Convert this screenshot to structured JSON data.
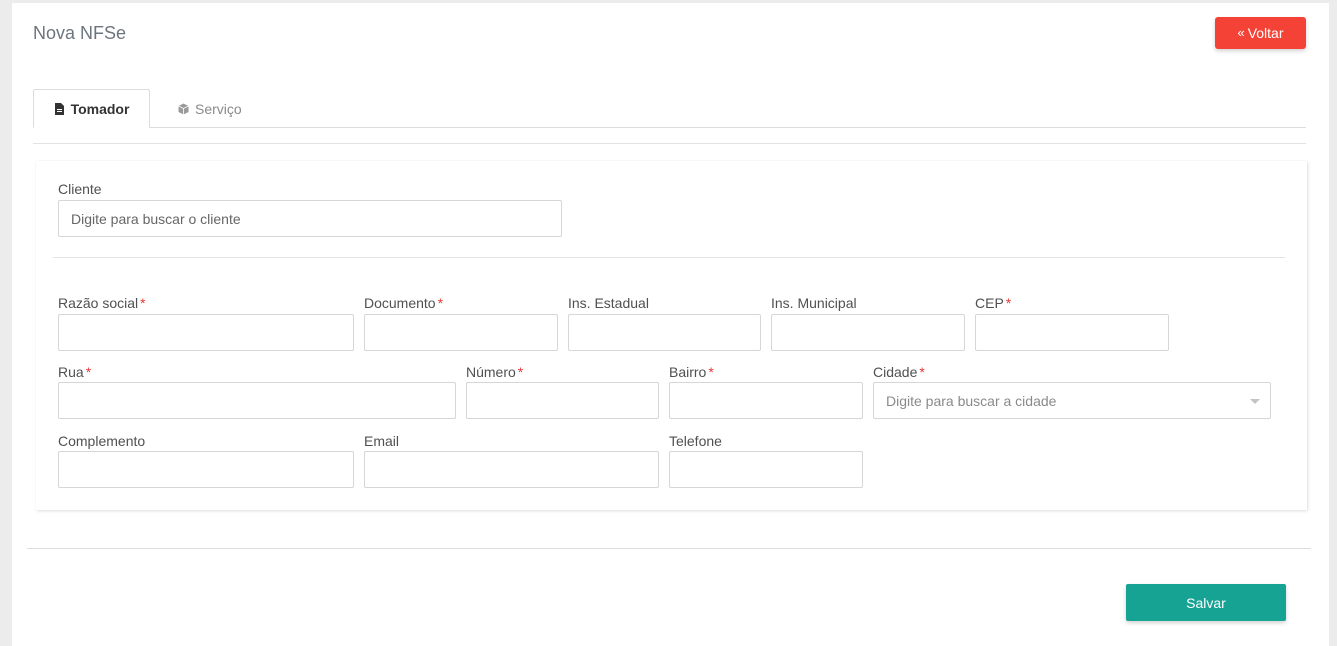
{
  "header": {
    "title": "Nova NFSe",
    "back_icon": "chevron-double-left-icon",
    "back_label": "Voltar"
  },
  "tabs": [
    {
      "label": "Tomador",
      "icon": "file-icon",
      "active": true
    },
    {
      "label": "Serviço",
      "icon": "cube-icon",
      "active": false
    }
  ],
  "form": {
    "cliente": {
      "label": "Cliente",
      "placeholder": "Digite para buscar o cliente",
      "value": ""
    },
    "razao_social": {
      "label": "Razão social",
      "required": "*",
      "value": ""
    },
    "documento": {
      "label": "Documento",
      "required": "*",
      "value": ""
    },
    "ins_estadual": {
      "label": "Ins. Estadual",
      "value": ""
    },
    "ins_municipal": {
      "label": "Ins. Municipal",
      "value": ""
    },
    "cep": {
      "label": "CEP",
      "required": "*",
      "value": ""
    },
    "rua": {
      "label": "Rua",
      "required": "*",
      "value": ""
    },
    "numero": {
      "label": "Número",
      "required": "*",
      "value": ""
    },
    "bairro": {
      "label": "Bairro",
      "required": "*",
      "value": ""
    },
    "cidade": {
      "label": "Cidade",
      "required": "*",
      "placeholder": "Digite para buscar a cidade"
    },
    "complemento": {
      "label": "Complemento",
      "value": ""
    },
    "email": {
      "label": "Email",
      "value": ""
    },
    "telefone": {
      "label": "Telefone",
      "value": ""
    }
  },
  "footer": {
    "save_label": "Salvar"
  },
  "colors": {
    "back_button": "#f44336",
    "save_button": "#17a393",
    "required_mark": "#e53935"
  }
}
